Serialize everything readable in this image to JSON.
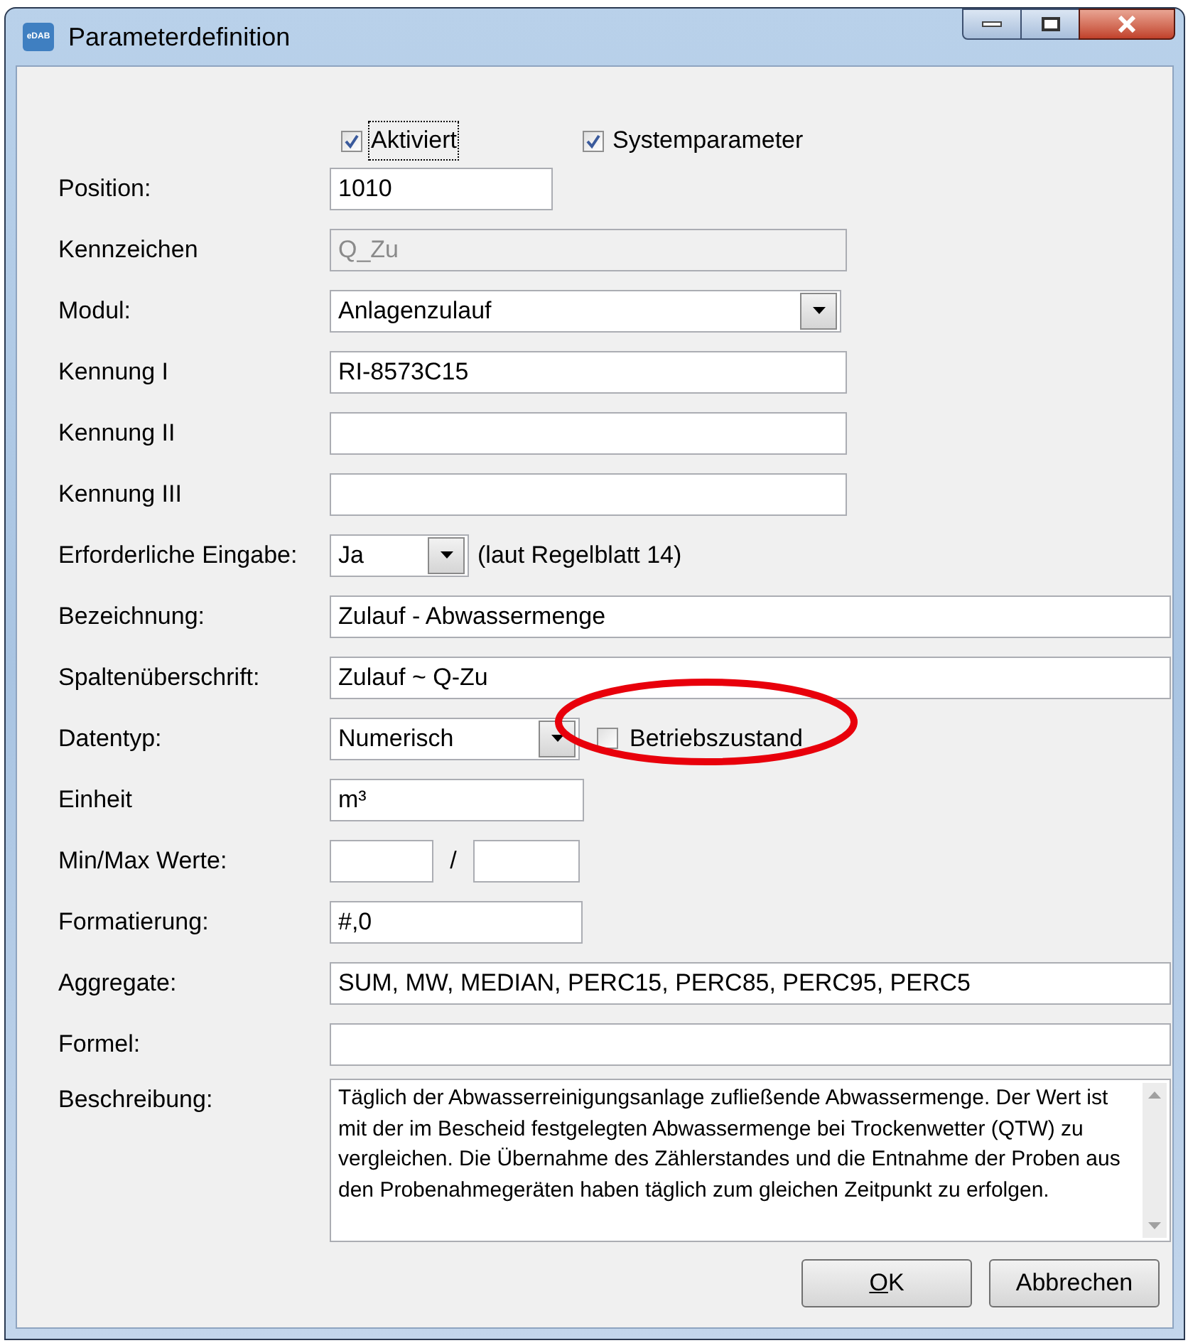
{
  "window": {
    "title": "Parameterdefinition",
    "app_badge": "eDAB"
  },
  "checkboxes": [
    {
      "label": "Aktiviert",
      "checked": true,
      "focused": true
    },
    {
      "label": "Systemparameter",
      "checked": true,
      "focused": false
    }
  ],
  "fields": [
    {
      "kind": "text",
      "label": "Position:",
      "value": "1010",
      "disabled": false
    },
    {
      "kind": "text",
      "label": "Kennzeichen",
      "value": "Q_Zu",
      "disabled": true
    },
    {
      "kind": "combo",
      "label": "Modul:",
      "value": "Anlagenzulauf"
    },
    {
      "kind": "text",
      "label": "Kennung I",
      "value": "RI-8573C15",
      "disabled": false
    },
    {
      "kind": "text",
      "label": "Kennung II",
      "disabled": false
    },
    {
      "kind": "text",
      "label": "Kennung III",
      "disabled": false
    },
    {
      "kind": "combo",
      "label": "Erforderliche Eingabe:",
      "value": "Ja",
      "note": "(laut Regelblatt 14)"
    },
    {
      "kind": "text",
      "label": "Bezeichnung:",
      "value": "Zulauf - Abwassermenge",
      "disabled": false
    },
    {
      "kind": "text",
      "label": "Spaltenüberschrift:",
      "value": "Zulauf ~ Q-Zu",
      "disabled": false
    },
    {
      "kind": "combo",
      "label": "Datentyp:",
      "value": "Numerisch",
      "checkbox": {
        "label": "Betriebszustand",
        "checked": false,
        "highlighted": true
      }
    },
    {
      "kind": "text",
      "label": "Einheit",
      "value": "m³",
      "disabled": false
    },
    {
      "kind": "minmax",
      "label": "Min/Max Werte:",
      "separator": "/"
    },
    {
      "kind": "text",
      "label": "Formatierung:",
      "value": "#,0",
      "disabled": false
    },
    {
      "kind": "text",
      "label": "Aggregate:",
      "value": "SUM, MW, MEDIAN, PERC15, PERC85, PERC95, PERC5",
      "disabled": false
    },
    {
      "kind": "text",
      "label": "Formel:",
      "disabled": false
    },
    {
      "kind": "textarea",
      "label": "Beschreibung:",
      "value": "Täglich der Abwasserreinigungsanlage zufließende Abwassermenge. Der Wert ist mit der im Bescheid festgelegten Abwassermenge bei Trockenwetter (QTW) zu vergleichen. Die Übernahme des Zählerstandes und die Entnahme der Proben aus den Probenahmegeräten haben täglich zum gleichen Zeitpunkt zu erfolgen."
    }
  ],
  "buttons": [
    {
      "label": "OK",
      "mnemonic": true
    },
    {
      "label": "Abbrechen",
      "mnemonic": false
    }
  ]
}
